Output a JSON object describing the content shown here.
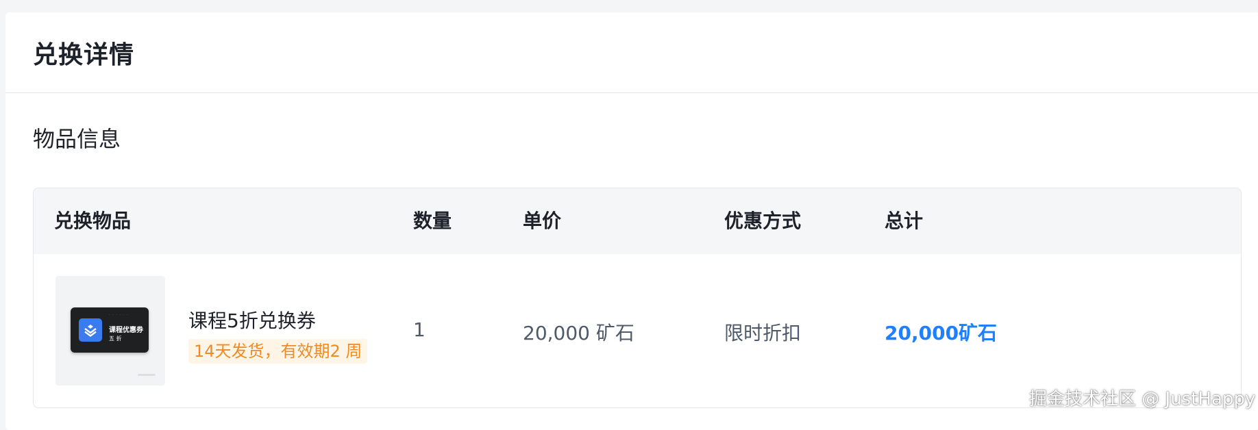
{
  "header": {
    "title": "兑换详情"
  },
  "section": {
    "title": "物品信息"
  },
  "table": {
    "columns": {
      "item": "兑换物品",
      "quantity": "数量",
      "unit_price": "单价",
      "discount": "优惠方式",
      "total": "总计"
    },
    "rows": [
      {
        "item_name": "课程5折兑换券",
        "item_tag": "14天发货，有效期2 周",
        "quantity": "1",
        "unit_price": "20,000 矿石",
        "discount": "限时折扣",
        "total": "20,000矿石",
        "thumbnail": {
          "icon": "juejin-logo-icon",
          "title": "课程优惠券",
          "subtitle": "五 折"
        }
      }
    ]
  },
  "watermark": "掘金技术社区 @ JustHappy",
  "colors": {
    "accent": "#1e80ff",
    "tag_text": "#f08a24",
    "tag_bg": "#fff5e6",
    "header_bg": "#f5f6f7"
  }
}
